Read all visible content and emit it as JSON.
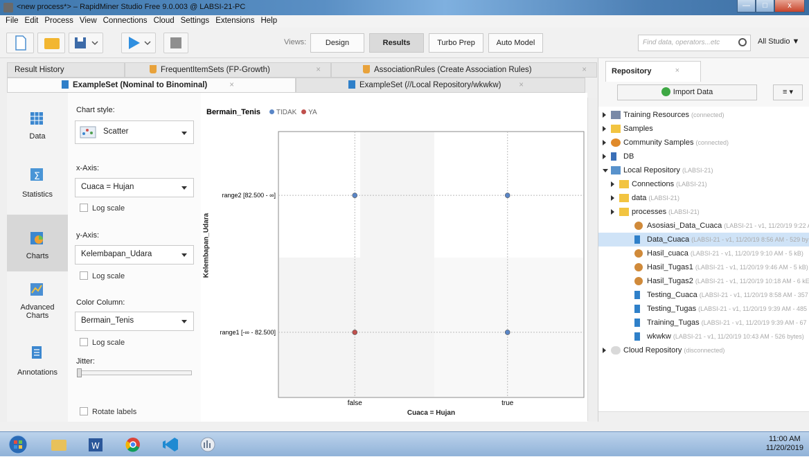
{
  "window": {
    "title": "<new process*> – RapidMiner Studio Free 9.0.003 @ LABSI-21-PC",
    "minimize": "—",
    "maximize": "□",
    "close": "x"
  },
  "menu": [
    "File",
    "Edit",
    "Process",
    "View",
    "Connections",
    "Cloud",
    "Settings",
    "Extensions",
    "Help"
  ],
  "toolbar": {
    "views_label": "Views:",
    "views": [
      "Design",
      "Results",
      "Turbo Prep",
      "Auto Model"
    ],
    "active_view": "Results",
    "search_placeholder": "Find data, operators...etc",
    "studio_label": "All Studio ▼"
  },
  "tabs_row1": [
    {
      "label": "Result History"
    },
    {
      "label": "FrequentItemSets (FP-Growth)"
    },
    {
      "label": "AssociationRules (Create Association Rules)"
    }
  ],
  "tabs_row2": [
    {
      "label": "ExampleSet (Nominal to Binominal)"
    },
    {
      "label": "ExampleSet (//Local Repository/wkwkw)"
    }
  ],
  "sidenav": [
    {
      "label": "Data",
      "icon": "table-icon"
    },
    {
      "label": "Statistics",
      "icon": "statistics-icon"
    },
    {
      "label": "Charts",
      "icon": "charts-icon"
    },
    {
      "label": "Advanced\nCharts",
      "icon": "advanced-charts-icon"
    },
    {
      "label": "Annotations",
      "icon": "annotations-icon"
    }
  ],
  "settings": {
    "chart_style_label": "Chart style:",
    "chart_style_value": "Scatter",
    "x_axis_label": "x-Axis:",
    "x_axis_value": "Cuaca = Hujan",
    "log_scale": "Log scale",
    "y_axis_label": "y-Axis:",
    "y_axis_value": "Kelembapan_Udara",
    "color_label": "Color Column:",
    "color_value": "Bermain_Tenis",
    "jitter_label": "Jitter:",
    "jitter": 0,
    "rotate_labels": "Rotate labels"
  },
  "chart_data": {
    "type": "scatter",
    "legend_title": "Bermain_Tenis",
    "series": [
      {
        "name": "TIDAK",
        "color": "#5a86c7",
        "points": [
          [
            "false",
            "range2 [82.500 - ∞]"
          ],
          [
            "true",
            "range2 [82.500 - ∞]"
          ],
          [
            "true",
            "range1 [-∞ - 82.500]"
          ]
        ]
      },
      {
        "name": "YA",
        "color": "#c0504d",
        "points": [
          [
            "false",
            "range1 [-∞ - 82.500]"
          ]
        ]
      }
    ],
    "x_categories": [
      "false",
      "true"
    ],
    "y_categories": [
      "range1 [-∞ - 82.500]",
      "range2 [82.500 - ∞]"
    ],
    "xlabel": "Cuaca = Hujan",
    "ylabel": "Kelembapan_Udara"
  },
  "repository": {
    "tab": "Repository",
    "import_button": "Import Data",
    "menu_button": "≡ ▾",
    "nodes": [
      {
        "name": "Training Resources",
        "meta": "(connected)",
        "icon": "res",
        "arrow": "right",
        "indent": 0
      },
      {
        "name": "Samples",
        "meta": "",
        "icon": "folder",
        "arrow": "right",
        "indent": 0
      },
      {
        "name": "Community Samples",
        "meta": "(connected)",
        "icon": "comm",
        "arrow": "right",
        "indent": 0
      },
      {
        "name": "DB",
        "meta": "",
        "icon": "db",
        "arrow": "right",
        "indent": 0
      },
      {
        "name": "Local Repository",
        "meta": "(LABSI-21)",
        "icon": "local",
        "arrow": "down",
        "indent": 0
      },
      {
        "name": "Connections",
        "meta": "(LABSI-21)",
        "icon": "folder",
        "arrow": "right",
        "indent": 1
      },
      {
        "name": "data",
        "meta": "(LABSI-21)",
        "icon": "folder",
        "arrow": "right",
        "indent": 1
      },
      {
        "name": "processes",
        "meta": "(LABSI-21)",
        "icon": "folder",
        "arrow": "right",
        "indent": 1
      },
      {
        "name": "Asosiasi_Data_Cuaca",
        "meta": "(LABSI-21 - v1, 11/20/19 9:22 A",
        "icon": "proc",
        "arrow": "",
        "indent": 2
      },
      {
        "name": "Data_Cuaca",
        "meta": "(LABSI-21 - v1, 11/20/19 8:56 AM - 529 by",
        "icon": "data",
        "arrow": "",
        "indent": 2,
        "selected": true
      },
      {
        "name": "Hasil_cuaca",
        "meta": "(LABSI-21 - v1, 11/20/19 9:10 AM - 5 kB)",
        "icon": "proc",
        "arrow": "",
        "indent": 2
      },
      {
        "name": "Hasil_Tugas1",
        "meta": "(LABSI-21 - v1, 11/20/19 9:46 AM - 5 kB)",
        "icon": "proc",
        "arrow": "",
        "indent": 2
      },
      {
        "name": "Hasil_Tugas2",
        "meta": "(LABSI-21 - v1, 11/20/19 10:18 AM - 6 kE",
        "icon": "proc",
        "arrow": "",
        "indent": 2
      },
      {
        "name": "Testing_Cuaca",
        "meta": "(LABSI-21 - v1, 11/20/19 8:58 AM - 357",
        "icon": "data",
        "arrow": "",
        "indent": 2
      },
      {
        "name": "Testing_Tugas",
        "meta": "(LABSI-21 - v1, 11/20/19 9:39 AM - 485",
        "icon": "data",
        "arrow": "",
        "indent": 2
      },
      {
        "name": "Training_Tugas",
        "meta": "(LABSI-21 - v1, 11/20/19 9:39 AM - 67",
        "icon": "data",
        "arrow": "",
        "indent": 2
      },
      {
        "name": "wkwkw",
        "meta": "(LABSI-21 - v1, 11/20/19 10:43 AM - 526 bytes)",
        "icon": "data",
        "arrow": "",
        "indent": 2
      },
      {
        "name": "Cloud Repository",
        "meta": "(disconnected)",
        "icon": "cloud",
        "arrow": "right",
        "indent": 0
      }
    ]
  },
  "taskbar": {
    "time": "11:00 AM",
    "date": "11/20/2019"
  }
}
